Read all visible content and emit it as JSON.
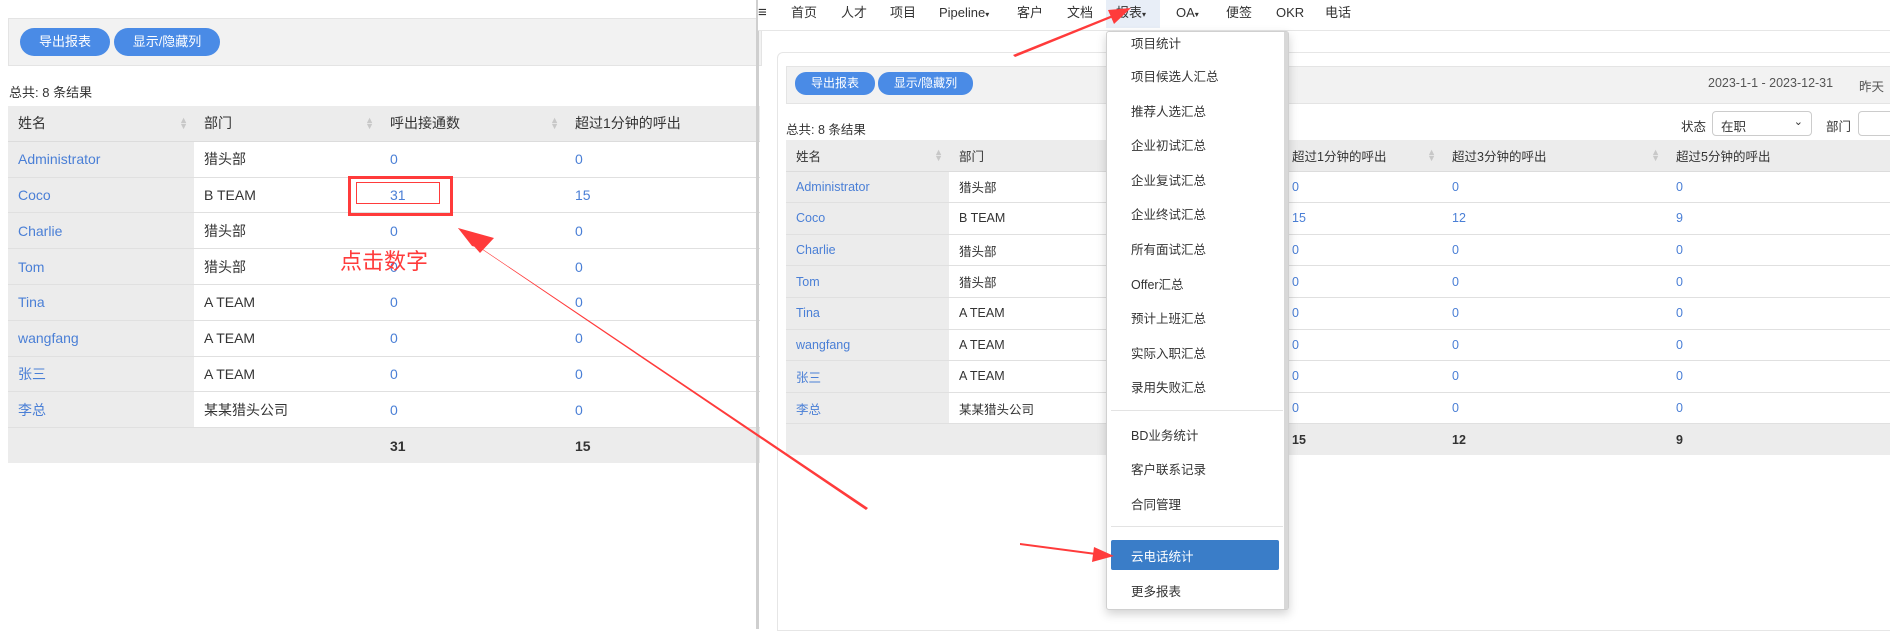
{
  "left": {
    "buttons": {
      "export": "导出报表",
      "toggle_columns": "显示/隐藏列"
    },
    "total": "总共: 8 条结果",
    "columns": [
      "姓名",
      "部门",
      "呼出接通数",
      "超过1分钟的呼出"
    ],
    "rows": [
      {
        "name": "Administrator",
        "dept": "猎头部",
        "c1": "0",
        "c2": "0"
      },
      {
        "name": "Coco",
        "dept": "B TEAM",
        "c1": "31",
        "c2": "15"
      },
      {
        "name": "Charlie",
        "dept": "猎头部",
        "c1": "0",
        "c2": "0"
      },
      {
        "name": "Tom",
        "dept": "猎头部",
        "c1": "0",
        "c2": "0"
      },
      {
        "name": "Tina",
        "dept": "A TEAM",
        "c1": "0",
        "c2": "0"
      },
      {
        "name": "wangfang",
        "dept": "A TEAM",
        "c1": "0",
        "c2": "0"
      },
      {
        "name": "张三",
        "dept": "A TEAM",
        "c1": "0",
        "c2": "0"
      },
      {
        "name": "李总",
        "dept": "某某猎头公司",
        "c1": "0",
        "c2": "0"
      }
    ],
    "totals": {
      "c1": "31",
      "c2": "15"
    }
  },
  "annotation": {
    "click_hint": "点击数字",
    "color": "#ff3b3b"
  },
  "right": {
    "nav": {
      "menu_icon": "≡",
      "items": [
        "首页",
        "人才",
        "项目",
        "Pipeline",
        "客户",
        "文档",
        "报表",
        "OA",
        "便签",
        "OKR",
        "电话"
      ]
    },
    "buttons": {
      "export": "导出报表",
      "toggle_columns": "显示/隐藏列"
    },
    "date_range": "2023-1-1 - 2023-12-31",
    "date_shortcut": "昨天",
    "total": "总共: 8 条结果",
    "status_label": "状态",
    "status_value": "在职",
    "dept_label": "部门",
    "columns": [
      "姓名",
      "部门",
      "",
      "超过1分钟的呼出",
      "超过3分钟的呼出",
      "超过5分钟的呼出"
    ],
    "rows": [
      {
        "name": "Administrator",
        "dept": "猎头部",
        "c2": "0",
        "c3": "0",
        "c5": "0"
      },
      {
        "name": "Coco",
        "dept": "B TEAM",
        "c2": "15",
        "c3": "12",
        "c5": "9"
      },
      {
        "name": "Charlie",
        "dept": "猎头部",
        "c2": "0",
        "c3": "0",
        "c5": "0"
      },
      {
        "name": "Tom",
        "dept": "猎头部",
        "c2": "0",
        "c3": "0",
        "c5": "0"
      },
      {
        "name": "Tina",
        "dept": "A TEAM",
        "c2": "0",
        "c3": "0",
        "c5": "0"
      },
      {
        "name": "wangfang",
        "dept": "A TEAM",
        "c2": "0",
        "c3": "0",
        "c5": "0"
      },
      {
        "name": "张三",
        "dept": "A TEAM",
        "c2": "0",
        "c3": "0",
        "c5": "0"
      },
      {
        "name": "李总",
        "dept": "某某猎头公司",
        "c2": "0",
        "c3": "0",
        "c5": "0"
      }
    ],
    "totals": {
      "c2": "15",
      "c3": "12",
      "c5": "9"
    },
    "dropdown": {
      "group1": [
        "项目统计",
        "项目候选人汇总",
        "推荐人选汇总",
        "企业初试汇总",
        "企业复试汇总",
        "企业终试汇总",
        "所有面试汇总",
        "Offer汇总",
        "预计上班汇总",
        "实际入职汇总",
        "录用失败汇总"
      ],
      "group2": [
        "BD业务统计",
        "客户联系记录",
        "合同管理"
      ],
      "group3": [
        "云电话统计",
        "更多报表"
      ]
    }
  }
}
